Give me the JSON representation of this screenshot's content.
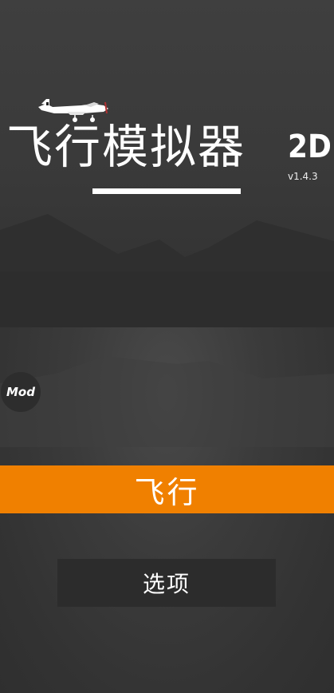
{
  "game": {
    "title": "飞行模拟器",
    "title_suffix": "2D",
    "version": "v1.4.3"
  },
  "badges": {
    "mod": "Mod"
  },
  "menu": {
    "fly_label": "飞行",
    "options_label": "选项"
  },
  "icons": {
    "plane": "airplane-icon"
  },
  "colors": {
    "primary_button": "#f08000",
    "background": "#363636",
    "secondary_button": "#2c2c2c"
  }
}
